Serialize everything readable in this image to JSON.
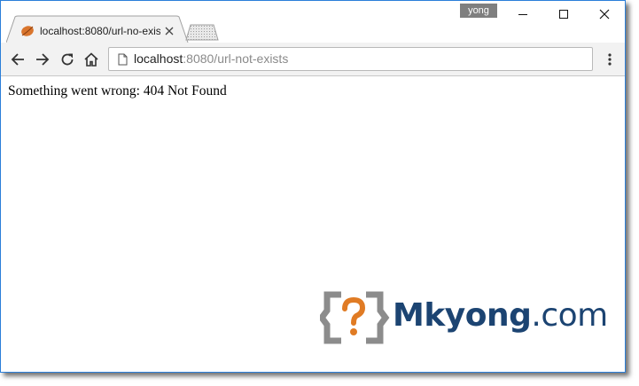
{
  "window": {
    "profile_name": "yong",
    "controls": {
      "minimize": "minimize-icon",
      "maximize": "maximize-icon",
      "close": "close-icon"
    }
  },
  "tabs": [
    {
      "title": "localhost:8080/url-no-exis",
      "favicon": "leaf-icon",
      "active": true
    }
  ],
  "toolbar": {
    "back_icon": "back-arrow-icon",
    "forward_icon": "forward-arrow-icon",
    "reload_icon": "reload-icon",
    "home_icon": "home-icon",
    "url_host": "localhost",
    "url_rest": ":8080/url-not-exists",
    "menu_icon": "kebab-menu-icon"
  },
  "page": {
    "message": "Something went wrong: 404 Not Found"
  },
  "watermark": {
    "brand": "Mkyong",
    "domain": ".com",
    "colors": {
      "brand": "#1c4472",
      "icon_orange": "#e07b24",
      "icon_gray": "#8c8c8c"
    }
  },
  "colors": {
    "accent_border": "#2b7fd9",
    "toolbar_bg": "#f2f2f2"
  }
}
